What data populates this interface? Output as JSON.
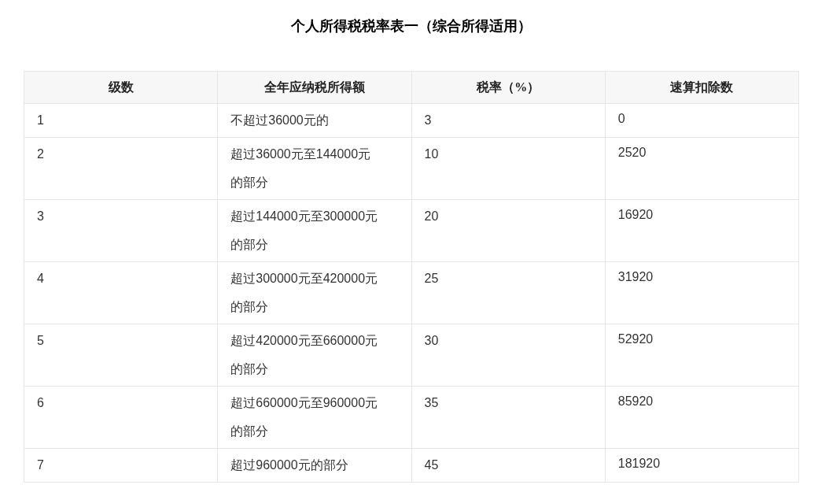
{
  "title": "个人所得税税率表一（综合所得适用）",
  "table": {
    "columns": [
      "级数",
      "全年应纳税所得额",
      "税率（%）",
      "速算扣除数"
    ],
    "rows": [
      {
        "level": "1",
        "income": "不超过36000元的",
        "rate": "3",
        "deduction": "0"
      },
      {
        "level": "2",
        "income": "超过36000元至144000元的部分",
        "rate": "10",
        "deduction": "2520"
      },
      {
        "level": "3",
        "income": "超过144000元至300000元的部分",
        "rate": "20",
        "deduction": "16920"
      },
      {
        "level": "4",
        "income": "超过300000元至420000元的部分",
        "rate": "25",
        "deduction": "31920"
      },
      {
        "level": "5",
        "income": "超过420000元至660000元的部分",
        "rate": "30",
        "deduction": "52920"
      },
      {
        "level": "6",
        "income": "超过660000元至960000元的部分",
        "rate": "35",
        "deduction": "85920"
      },
      {
        "level": "7",
        "income": "超过960000元的部分",
        "rate": "45",
        "deduction": "181920"
      }
    ]
  }
}
